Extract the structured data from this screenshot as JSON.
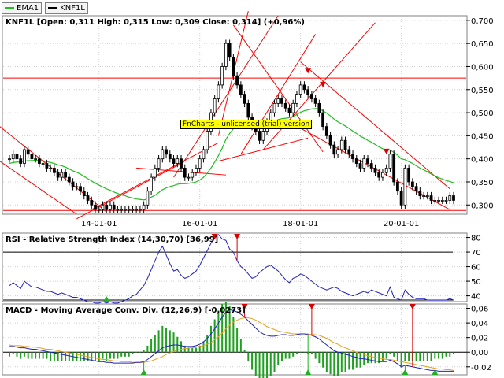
{
  "legend": [
    {
      "label": "EMA1",
      "color": "#1fbf1f"
    },
    {
      "label": "KNF1L",
      "color": "#000000"
    }
  ],
  "price_panel": {
    "title": "KNF1L [Open: 0,311  High: 0,315  Low: 0,309  Close: 0,314] (+0,96%)"
  },
  "rsi_panel": {
    "title": "RSI - Relative Strength Index (14,30,70) [36,99]"
  },
  "macd_panel": {
    "title": "MACD - Moving Average Conv. Div. (12,26,9) [-0,0273]"
  },
  "watermark": "FnCharts - unlicensed (trial) version",
  "colors": {
    "candle": "#000000",
    "ema": "#1fbf1f",
    "rsi_line": "#2020c0",
    "macd_line": "#2020c0",
    "signal_line": "#e6a020",
    "histogram": "#20a020",
    "channel": "#ff0000",
    "signal_arrow_sell": "#dd0000",
    "signal_arrow_buy": "#20b020"
  },
  "chart_data": [
    {
      "type": "candlestick",
      "name": "price",
      "ylim": [
        0.28,
        0.71
      ],
      "yticks": [
        "0,700",
        "0,650",
        "0,600",
        "0,550",
        "0,500",
        "0,450",
        "0,400",
        "0,350",
        "0,300"
      ],
      "ytick_values": [
        0.7,
        0.65,
        0.6,
        0.55,
        0.5,
        0.45,
        0.4,
        0.35,
        0.3
      ],
      "xticks": [
        "14-01-01",
        "16-01-01",
        "18-01-01",
        "20-01-01"
      ],
      "xtick_index": [
        24,
        51,
        78,
        105
      ],
      "close": [
        0.4,
        0.41,
        0.4,
        0.39,
        0.42,
        0.41,
        0.4,
        0.4,
        0.39,
        0.39,
        0.38,
        0.38,
        0.37,
        0.36,
        0.37,
        0.36,
        0.35,
        0.34,
        0.34,
        0.33,
        0.32,
        0.31,
        0.3,
        0.29,
        0.29,
        0.3,
        0.29,
        0.3,
        0.29,
        0.29,
        0.29,
        0.29,
        0.29,
        0.29,
        0.29,
        0.29,
        0.3,
        0.33,
        0.36,
        0.38,
        0.4,
        0.42,
        0.41,
        0.4,
        0.39,
        0.4,
        0.38,
        0.36,
        0.36,
        0.37,
        0.38,
        0.4,
        0.42,
        0.46,
        0.5,
        0.53,
        0.56,
        0.6,
        0.65,
        0.62,
        0.58,
        0.56,
        0.54,
        0.52,
        0.49,
        0.47,
        0.46,
        0.44,
        0.46,
        0.48,
        0.5,
        0.52,
        0.53,
        0.52,
        0.51,
        0.5,
        0.52,
        0.54,
        0.56,
        0.55,
        0.54,
        0.53,
        0.52,
        0.5,
        0.47,
        0.45,
        0.43,
        0.41,
        0.42,
        0.44,
        0.42,
        0.41,
        0.4,
        0.39,
        0.38,
        0.4,
        0.39,
        0.38,
        0.37,
        0.36,
        0.37,
        0.38,
        0.41,
        0.35,
        0.33,
        0.3,
        0.38,
        0.35,
        0.34,
        0.33,
        0.32,
        0.32,
        0.32,
        0.31,
        0.31,
        0.31,
        0.31,
        0.31,
        0.32,
        0.31
      ],
      "ema": [
        0.39,
        0.392,
        0.393,
        0.393,
        0.395,
        0.396,
        0.396,
        0.397,
        0.396,
        0.395,
        0.394,
        0.392,
        0.39,
        0.387,
        0.385,
        0.382,
        0.378,
        0.374,
        0.371,
        0.367,
        0.362,
        0.357,
        0.352,
        0.347,
        0.343,
        0.339,
        0.335,
        0.332,
        0.328,
        0.325,
        0.322,
        0.32,
        0.317,
        0.315,
        0.313,
        0.312,
        0.311,
        0.313,
        0.317,
        0.321,
        0.327,
        0.333,
        0.337,
        0.34,
        0.342,
        0.345,
        0.346,
        0.346,
        0.347,
        0.348,
        0.35,
        0.354,
        0.36,
        0.369,
        0.38,
        0.393,
        0.407,
        0.423,
        0.442,
        0.455,
        0.465,
        0.472,
        0.478,
        0.481,
        0.482,
        0.481,
        0.48,
        0.477,
        0.476,
        0.476,
        0.478,
        0.481,
        0.485,
        0.487,
        0.488,
        0.489,
        0.492,
        0.496,
        0.501,
        0.504,
        0.506,
        0.508,
        0.509,
        0.508,
        0.504,
        0.499,
        0.493,
        0.486,
        0.48,
        0.476,
        0.471,
        0.466,
        0.46,
        0.455,
        0.449,
        0.445,
        0.44,
        0.436,
        0.431,
        0.426,
        0.422,
        0.419,
        0.419,
        0.414,
        0.408,
        0.4,
        0.398,
        0.394,
        0.39,
        0.385,
        0.38,
        0.376,
        0.372,
        0.367,
        0.363,
        0.359,
        0.356,
        0.353,
        0.351,
        0.348
      ]
    },
    {
      "type": "line",
      "name": "RSI",
      "ylim": [
        36,
        83
      ],
      "yticks": [
        "80",
        "70",
        "60",
        "50",
        "40"
      ],
      "ytick_values": [
        80,
        70,
        60,
        50,
        40
      ],
      "reference_lines": [
        30,
        70
      ],
      "values": [
        47,
        49,
        47,
        45,
        50,
        48,
        46,
        46,
        45,
        44,
        43,
        43,
        42,
        41,
        42,
        41,
        40,
        39,
        39,
        38,
        37,
        36,
        36,
        35,
        35,
        36,
        35,
        36,
        35,
        35,
        36,
        37,
        38,
        40,
        41,
        44,
        47,
        52,
        58,
        64,
        70,
        74,
        68,
        62,
        57,
        58,
        54,
        52,
        53,
        55,
        57,
        61,
        66,
        71,
        76,
        80,
        82,
        79,
        78,
        72,
        70,
        64,
        60,
        58,
        55,
        52,
        53,
        56,
        58,
        60,
        61,
        59,
        57,
        54,
        51,
        49,
        52,
        53,
        55,
        54,
        52,
        50,
        48,
        46,
        45,
        44,
        45,
        46,
        45,
        43,
        42,
        41,
        40,
        41,
        42,
        43,
        42,
        44,
        43,
        42,
        41,
        40,
        46,
        39,
        38,
        37,
        44,
        41,
        39,
        38,
        38,
        38,
        37,
        37,
        37,
        37,
        37,
        37,
        38,
        37
      ]
    },
    {
      "type": "line",
      "name": "MACD",
      "ylim": [
        -0.031,
        0.066
      ],
      "yticks": [
        "0,06",
        "0,04",
        "0,02",
        "0,00",
        "-0,02"
      ],
      "ytick_values": [
        0.06,
        0.04,
        0.02,
        0.0,
        -0.02
      ],
      "macd": [
        0.008,
        0.008,
        0.007,
        0.006,
        0.006,
        0.005,
        0.004,
        0.004,
        0.003,
        0.002,
        0.001,
        0.0,
        -0.001,
        -0.002,
        -0.003,
        -0.004,
        -0.005,
        -0.006,
        -0.007,
        -0.008,
        -0.009,
        -0.01,
        -0.011,
        -0.012,
        -0.013,
        -0.013,
        -0.014,
        -0.014,
        -0.015,
        -0.015,
        -0.015,
        -0.015,
        -0.015,
        -0.015,
        -0.014,
        -0.014,
        -0.013,
        -0.01,
        -0.006,
        -0.002,
        0.002,
        0.006,
        0.008,
        0.009,
        0.01,
        0.01,
        0.009,
        0.008,
        0.008,
        0.008,
        0.009,
        0.011,
        0.014,
        0.019,
        0.025,
        0.032,
        0.04,
        0.048,
        0.055,
        0.058,
        0.057,
        0.055,
        0.052,
        0.048,
        0.043,
        0.038,
        0.033,
        0.028,
        0.025,
        0.023,
        0.022,
        0.022,
        0.023,
        0.024,
        0.024,
        0.023,
        0.023,
        0.024,
        0.025,
        0.025,
        0.024,
        0.023,
        0.021,
        0.018,
        0.014,
        0.01,
        0.006,
        0.002,
        0.0,
        -0.001,
        -0.003,
        -0.004,
        -0.006,
        -0.007,
        -0.009,
        -0.009,
        -0.01,
        -0.011,
        -0.012,
        -0.013,
        -0.013,
        -0.013,
        -0.011,
        -0.013,
        -0.016,
        -0.02,
        -0.018,
        -0.019,
        -0.02,
        -0.021,
        -0.022,
        -0.023,
        -0.024,
        -0.025,
        -0.025,
        -0.026,
        -0.026,
        -0.026,
        -0.026,
        -0.026
      ],
      "signal": [
        0.01,
        0.009,
        0.009,
        0.009,
        0.008,
        0.008,
        0.007,
        0.007,
        0.006,
        0.005,
        0.004,
        0.004,
        0.003,
        0.002,
        0.001,
        0.0,
        -0.001,
        -0.002,
        -0.003,
        -0.004,
        -0.005,
        -0.006,
        -0.007,
        -0.008,
        -0.009,
        -0.01,
        -0.01,
        -0.011,
        -0.012,
        -0.012,
        -0.013,
        -0.013,
        -0.013,
        -0.014,
        -0.014,
        -0.014,
        -0.014,
        -0.013,
        -0.012,
        -0.01,
        -0.008,
        -0.006,
        -0.003,
        -0.001,
        0.001,
        0.003,
        0.004,
        0.005,
        0.006,
        0.006,
        0.007,
        0.008,
        0.009,
        0.011,
        0.013,
        0.017,
        0.021,
        0.026,
        0.032,
        0.037,
        0.041,
        0.044,
        0.046,
        0.047,
        0.047,
        0.046,
        0.044,
        0.041,
        0.038,
        0.035,
        0.033,
        0.031,
        0.029,
        0.028,
        0.027,
        0.026,
        0.025,
        0.025,
        0.025,
        0.025,
        0.025,
        0.024,
        0.024,
        0.023,
        0.021,
        0.019,
        0.016,
        0.013,
        0.011,
        0.008,
        0.006,
        0.004,
        0.002,
        0.0,
        -0.002,
        -0.003,
        -0.005,
        -0.006,
        -0.007,
        -0.008,
        -0.009,
        -0.01,
        -0.01,
        -0.011,
        -0.012,
        -0.013,
        -0.014,
        -0.015,
        -0.016,
        -0.017,
        -0.018,
        -0.019,
        -0.02,
        -0.021,
        -0.022,
        -0.023,
        -0.023,
        -0.024,
        -0.024,
        -0.025
      ]
    }
  ]
}
